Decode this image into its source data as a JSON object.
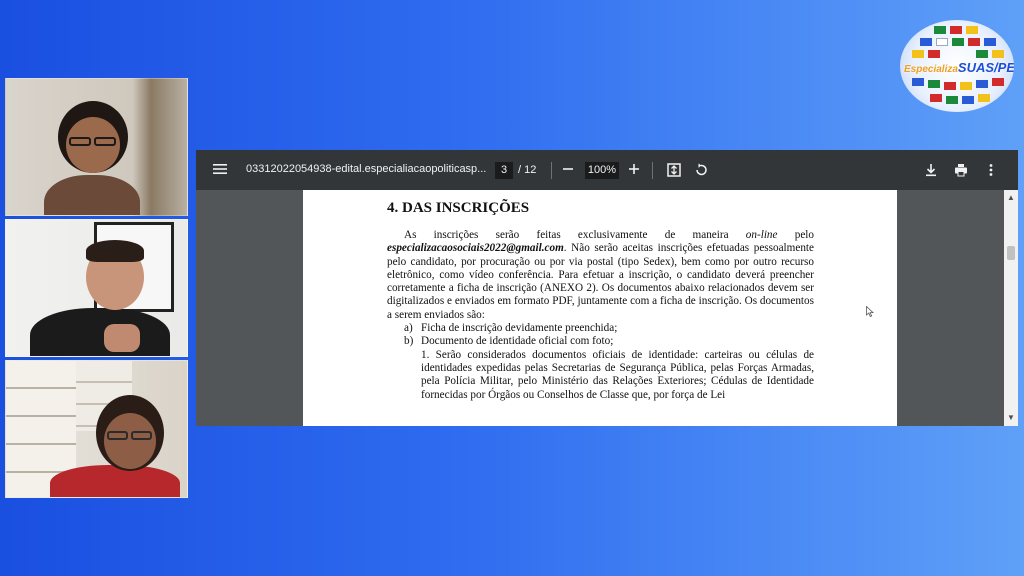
{
  "viewer": {
    "doc_title": "03312022054938-edital.especialiacaopoliticasp...",
    "current_page": "3",
    "total_pages": "/ 12",
    "zoom": "100%",
    "icons": {
      "menu": "menu-icon",
      "zoom_out": "minus-icon",
      "zoom_in": "plus-icon",
      "fit": "fit-page-icon",
      "rotate": "rotate-icon",
      "download": "download-icon",
      "print": "print-icon",
      "more": "more-vert-icon"
    }
  },
  "document": {
    "heading": "4. DAS INSCRIÇÕES",
    "para_start": "As inscrições serão feitas exclusivamente de maneira ",
    "para_online": "on-line",
    "para_pelo": " pelo ",
    "para_email": "especializacaosociais2022@gmail.com",
    "para_rest": ". Não serão aceitas inscrições efetuadas pessoalmente pelo candidato, por procuração ou por via postal (tipo Sedex), bem como por outro recurso eletrônico, como vídeo conferência. Para efetuar a inscrição, o candidato deverá preencher corretamente a ficha de inscrição (ANEXO 2). Os documentos abaixo relacionados devem ser digitalizados e enviados em formato PDF, juntamente com a ficha de inscrição. Os documentos a serem enviados são:",
    "items": [
      {
        "label": "a)",
        "text": "Ficha de inscrição devidamente preenchida;"
      },
      {
        "label": "b)",
        "text": "Documento de identidade oficial com foto;"
      }
    ],
    "sub_item": "1. Serão considerados documentos oficiais de identidade: carteiras ou células de identidades expedidas pelas Secretarias de Segurança Pública, pelas Forças Armadas, pela Polícia Militar, pelo Ministério das Relações Exteriores; Cédulas de Identidade fornecidas por Órgãos ou Conselhos de Classe que, por força de Lei"
  },
  "logo": {
    "prefix": "Especializa",
    "text": "SUAS/PE"
  },
  "colors": {
    "background_left": "#1a4fe0",
    "background_right": "#5fa0f8",
    "toolbar": "#323639",
    "viewer_bg": "#525659"
  }
}
